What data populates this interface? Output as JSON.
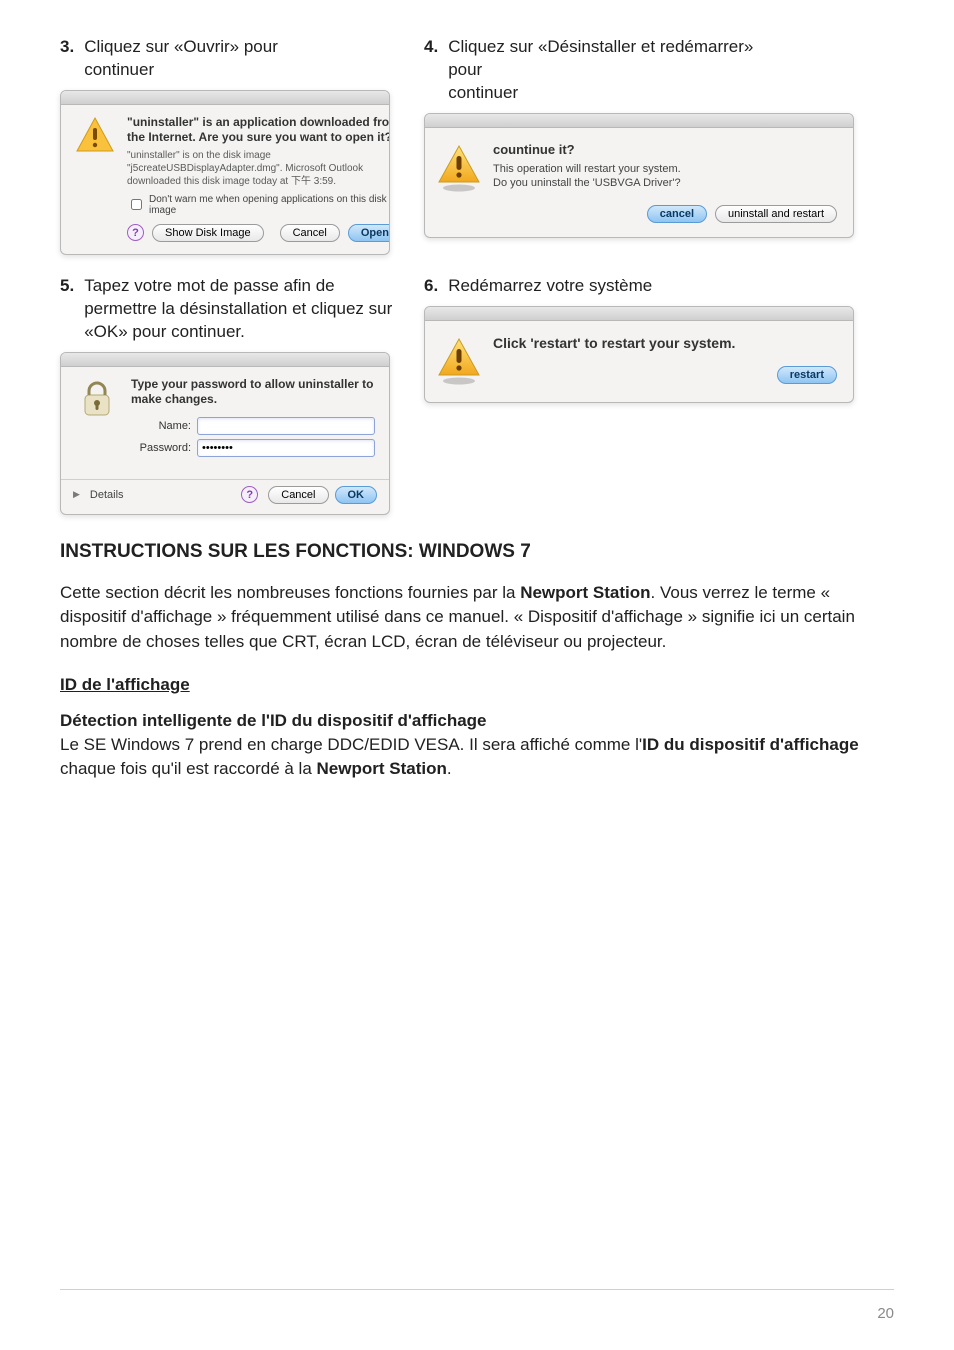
{
  "steps": {
    "s3": {
      "num": "3.",
      "text_a": "Cliquez sur «Ouvrir» pour ",
      "text_b": "continuer"
    },
    "s4": {
      "num": "4.",
      "text_a": "Cliquez sur «Désinstaller et redémarrer» ",
      "text_b": "pour",
      "text_c": "continuer"
    },
    "s5": {
      "num": "5.",
      "text_a": "Tapez votre mot de passe afin de permettre la désinstallation et ",
      "text_b": "cliquez sur «OK» pour continuer."
    },
    "s6": {
      "num": "6.",
      "text": "Redémarrez votre système"
    }
  },
  "dialog3": {
    "title": "\"uninstaller\" is an application downloaded from the Internet. Are you sure you want to open it?",
    "sub": "\"uninstaller\" is on the disk image \"j5createUSBDisplayAdapter.dmg\". Microsoft Outlook downloaded this disk image today at 下午 3:59.",
    "chk": "Don't warn me when opening applications on this disk image",
    "show_disk": "Show Disk Image",
    "cancel": "Cancel",
    "open": "Open"
  },
  "dialog4": {
    "title": "countinue it?",
    "line1": "This operation will restart your system.",
    "line2": "Do you uninstall the 'USBVGA Driver'?",
    "cancel": "cancel",
    "action": "uninstall and restart"
  },
  "dialog5": {
    "title": "Type your password to allow uninstaller to make changes.",
    "name_label": "Name:",
    "name_value": "",
    "pwd_label": "Password:",
    "pwd_value": "••••••••",
    "details": "Details",
    "cancel": "Cancel",
    "ok": "OK"
  },
  "dialog6": {
    "title": "Click 'restart' to restart your system.",
    "restart": "restart"
  },
  "body": {
    "heading": "INSTRUCTIONS SUR LES FONCTIONS: WINDOWS 7",
    "p1a": "Cette section décrit les nombreuses fonctions fournies par la ",
    "p1b": "Newport Station",
    "p1c": ". Vous verrez le terme « dispositif d'affichage » fréquemment utilisé dans ce manuel. « Dispositif d'affichage » signifie ici un certain nombre de choses telles que CRT, écran LCD, écran de téléviseur ou projecteur.",
    "sub_h": "ID de l'affichage",
    "sub_h2": "Détection intelligente de l'ID du dispositif d'affichage",
    "p2a": "Le SE Windows 7 prend en charge DDC/EDID VESA. Il sera affiché comme l'",
    "p2b": "ID du dispositif d'affichage",
    "p2c": " chaque fois qu'il est raccordé à la ",
    "p2d": "Newport Station",
    "p2e": "."
  },
  "page_num": "20"
}
